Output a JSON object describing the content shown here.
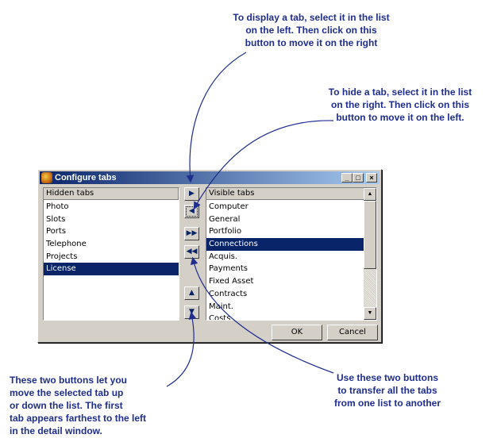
{
  "callouts": {
    "display_tab": [
      "To display a tab, select it in the list",
      "on the left. Then click on this",
      "button to move it on the right"
    ],
    "hide_tab": [
      "To hide a tab, select it in the list",
      "on the right. Then click on this",
      "button to move it on the left."
    ],
    "up_down": [
      "These two buttons let you",
      "move the selected tab up",
      "or down the list. The first",
      "tab appears farthest to the left",
      "in the detail window."
    ],
    "transfer": [
      "Use these two buttons",
      "to transfer all the tabs",
      "from one list to another"
    ]
  },
  "dialog": {
    "title": "Configure tabs",
    "titlebar_buttons": {
      "minimize": "_",
      "maximize": "□",
      "close": "×"
    },
    "hidden_tabs": {
      "header": "Hidden tabs",
      "items": [
        {
          "label": "Photo",
          "selected": false
        },
        {
          "label": "Slots",
          "selected": false
        },
        {
          "label": "Ports",
          "selected": false
        },
        {
          "label": "Telephone",
          "selected": false
        },
        {
          "label": "Projects",
          "selected": false
        },
        {
          "label": "License",
          "selected": true
        }
      ]
    },
    "visible_tabs": {
      "header": "Visible tabs",
      "items": [
        {
          "label": "Computer",
          "selected": false
        },
        {
          "label": "General",
          "selected": false
        },
        {
          "label": "Portfolio",
          "selected": false
        },
        {
          "label": "Connections",
          "selected": true
        },
        {
          "label": "Acquis.",
          "selected": false
        },
        {
          "label": "Payments",
          "selected": false
        },
        {
          "label": "Fixed Asset",
          "selected": false
        },
        {
          "label": "Contracts",
          "selected": false
        },
        {
          "label": "Maint.",
          "selected": false
        },
        {
          "label": "Costs",
          "selected": false
        }
      ]
    },
    "move_buttons": {
      "show": "▶",
      "hide": "◀",
      "show_all": "▶▶",
      "hide_all": "◀◀",
      "up": "▲",
      "down": "▼"
    },
    "ok_label": "OK",
    "cancel_label": "Cancel"
  },
  "colors": {
    "annotation": "#1f2d8f",
    "titlebar": "#0a246a",
    "selection": "#0a246a",
    "dialog_face": "#d4d0c8"
  }
}
